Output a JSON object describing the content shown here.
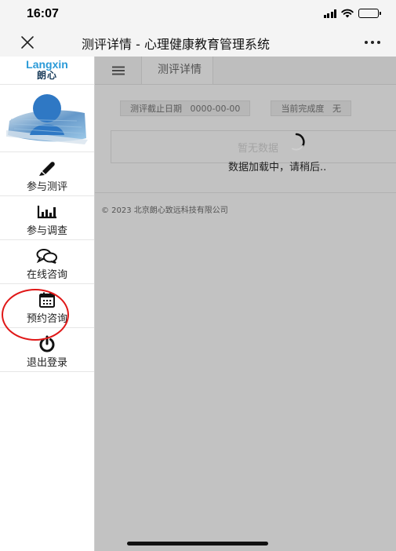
{
  "status_bar": {
    "time": "16:07"
  },
  "title_bar": {
    "title": "测评详情 - 心理健康教育管理系统"
  },
  "sidebar": {
    "logo_en": "Langxin",
    "logo_cn": "朗心",
    "items": [
      {
        "label": "参与测评",
        "icon": "pen-icon"
      },
      {
        "label": "参与调查",
        "icon": "bar-chart-icon"
      },
      {
        "label": "在线咨询",
        "icon": "chat-bubbles-icon"
      },
      {
        "label": "预约咨询",
        "icon": "calendar-icon",
        "highlighted": true
      },
      {
        "label": "退出登录",
        "icon": "power-icon"
      }
    ]
  },
  "main": {
    "tab_label": "测评详情",
    "deadline_label": "测评截止日期",
    "deadline_value": "0000-00-00",
    "progress_label": "当前完成度",
    "progress_value": "无",
    "empty_text": "暂无数据",
    "loading_text": "数据加载中，请稍后..",
    "copyright": "© 2023 北京朗心致远科技有限公司"
  },
  "colors": {
    "highlight_ring": "#e01818",
    "logo_blue": "#2a9ad8",
    "overlay": "rgba(120,120,120,0.45)"
  }
}
